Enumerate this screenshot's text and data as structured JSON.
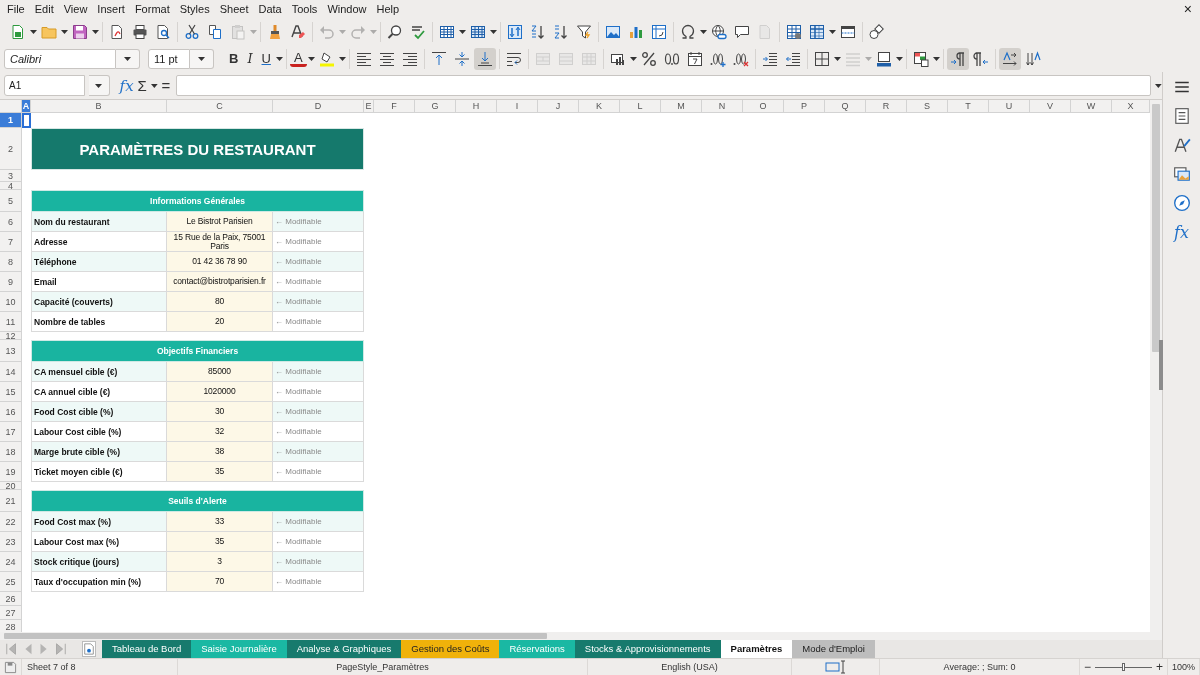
{
  "menu": [
    "File",
    "Edit",
    "View",
    "Insert",
    "Format",
    "Styles",
    "Sheet",
    "Data",
    "Tools",
    "Window",
    "Help"
  ],
  "close_label": "×",
  "standard_toolbar": [
    [
      {
        "kind": "new",
        "disabled": false
      },
      {
        "kind": "open",
        "disabled": false
      },
      {
        "kind": "save",
        "disabled": false
      }
    ],
    [
      {
        "kind": "pdf",
        "disabled": false
      },
      {
        "kind": "print",
        "disabled": false
      },
      {
        "kind": "preview",
        "disabled": false
      }
    ],
    [
      {
        "kind": "cut",
        "disabled": false
      },
      {
        "kind": "copy",
        "disabled": false
      },
      {
        "kind": "paste",
        "disabled": true
      }
    ],
    [
      {
        "kind": "clone",
        "disabled": false
      },
      {
        "kind": "clear",
        "disabled": false
      }
    ],
    [
      {
        "kind": "undo",
        "disabled": true
      },
      {
        "kind": "redo",
        "disabled": true
      }
    ],
    [
      {
        "kind": "find",
        "disabled": false
      },
      {
        "kind": "spelling",
        "disabled": false
      }
    ],
    [
      {
        "kind": "rows",
        "disabled": false
      },
      {
        "kind": "columns",
        "disabled": false
      }
    ],
    [
      {
        "kind": "sort",
        "disabled": false
      },
      {
        "kind": "sort-asc",
        "disabled": false
      },
      {
        "kind": "sort-desc",
        "disabled": false
      },
      {
        "kind": "filter",
        "disabled": false
      }
    ],
    [
      {
        "kind": "image",
        "disabled": false
      },
      {
        "kind": "chart",
        "disabled": false
      },
      {
        "kind": "pivot",
        "disabled": false
      }
    ],
    [
      {
        "kind": "special",
        "disabled": false
      },
      {
        "kind": "hyperlink",
        "disabled": false
      },
      {
        "kind": "comment",
        "disabled": false
      },
      {
        "kind": "header-footer",
        "disabled": true
      }
    ],
    [
      {
        "kind": "print-range",
        "disabled": false
      },
      {
        "kind": "freeze",
        "disabled": false
      },
      {
        "kind": "split",
        "disabled": false
      }
    ],
    [
      {
        "kind": "shapes",
        "disabled": false
      }
    ]
  ],
  "font_name": "Calibri",
  "font_size": "11 pt",
  "formatting_toolbar": [
    [
      {
        "kind": "bold",
        "label": "B",
        "disabled": false,
        "on": false
      },
      {
        "kind": "italic",
        "label": "I",
        "disabled": false,
        "on": false
      },
      {
        "kind": "underline",
        "label": "U",
        "disabled": false,
        "on": false
      }
    ],
    [
      {
        "kind": "font-color",
        "label": "A",
        "disabled": false,
        "on": false
      },
      {
        "kind": "highlight",
        "disabled": false,
        "on": false
      }
    ],
    [
      {
        "kind": "align-left",
        "disabled": false,
        "on": false
      },
      {
        "kind": "align-center",
        "disabled": false,
        "on": false
      },
      {
        "kind": "align-right",
        "disabled": false,
        "on": false
      }
    ],
    [
      {
        "kind": "align-top",
        "disabled": false,
        "on": false
      },
      {
        "kind": "align-middle",
        "disabled": false,
        "on": false
      },
      {
        "kind": "align-bottom",
        "disabled": false,
        "on": true
      }
    ],
    [
      {
        "kind": "wrap",
        "disabled": false,
        "on": false
      }
    ],
    [
      {
        "kind": "merge-center",
        "disabled": true,
        "on": false
      },
      {
        "kind": "merge",
        "disabled": true,
        "on": false
      },
      {
        "kind": "unmerge",
        "disabled": true,
        "on": false
      }
    ],
    [
      {
        "kind": "number-format",
        "disabled": false,
        "on": false
      },
      {
        "kind": "percent",
        "disabled": false,
        "on": false
      },
      {
        "kind": "standard-number",
        "disabled": false,
        "on": false
      },
      {
        "kind": "date",
        "disabled": false,
        "on": false
      },
      {
        "kind": "add-decimal",
        "disabled": false,
        "on": false
      },
      {
        "kind": "delete-decimal",
        "disabled": false,
        "on": false
      }
    ],
    [
      {
        "kind": "indent",
        "disabled": false,
        "on": false
      },
      {
        "kind": "outdent",
        "disabled": false,
        "on": false
      }
    ],
    [
      {
        "kind": "borders",
        "disabled": false,
        "on": false
      },
      {
        "kind": "border-style",
        "disabled": true,
        "on": false
      },
      {
        "kind": "border-color",
        "disabled": false,
        "on": false
      }
    ],
    [
      {
        "kind": "conditional",
        "disabled": false,
        "on": false
      }
    ],
    [
      {
        "kind": "ltr",
        "disabled": false,
        "on": true
      },
      {
        "kind": "rtl",
        "disabled": false,
        "on": false
      }
    ],
    [
      {
        "kind": "text-ltr",
        "disabled": false,
        "on": true
      },
      {
        "kind": "text-ttb",
        "disabled": false,
        "on": false
      }
    ]
  ],
  "formula_bar": {
    "name_box": "A1",
    "function_wizard": "fx",
    "sum": "Σ",
    "equals": "="
  },
  "grid": {
    "columns": [
      {
        "label": "A",
        "selected": true
      },
      {
        "label": "B",
        "selected": false
      },
      {
        "label": "C",
        "selected": false
      },
      {
        "label": "D",
        "selected": false
      },
      {
        "label": "E",
        "selected": false
      },
      {
        "label": "F",
        "selected": false
      },
      {
        "label": "G",
        "selected": false
      },
      {
        "label": "H",
        "selected": false
      },
      {
        "label": "I",
        "selected": false
      },
      {
        "label": "J",
        "selected": false
      },
      {
        "label": "K",
        "selected": false
      },
      {
        "label": "L",
        "selected": false
      },
      {
        "label": "M",
        "selected": false
      },
      {
        "label": "N",
        "selected": false
      },
      {
        "label": "O",
        "selected": false
      },
      {
        "label": "P",
        "selected": false
      },
      {
        "label": "Q",
        "selected": false
      },
      {
        "label": "R",
        "selected": false
      },
      {
        "label": "S",
        "selected": false
      },
      {
        "label": "T",
        "selected": false
      },
      {
        "label": "U",
        "selected": false
      },
      {
        "label": "V",
        "selected": false
      },
      {
        "label": "W",
        "selected": false
      },
      {
        "label": "X",
        "selected": false
      }
    ],
    "rows": [
      {
        "label": "1",
        "selected": true
      },
      {
        "label": "2",
        "selected": false
      },
      {
        "label": "3",
        "selected": false
      },
      {
        "label": "4",
        "selected": false
      },
      {
        "label": "5",
        "selected": false
      },
      {
        "label": "6",
        "selected": false
      },
      {
        "label": "7",
        "selected": false
      },
      {
        "label": "8",
        "selected": false
      },
      {
        "label": "9",
        "selected": false
      },
      {
        "label": "10",
        "selected": false
      },
      {
        "label": "11",
        "selected": false
      },
      {
        "label": "12",
        "selected": false
      },
      {
        "label": "13",
        "selected": false
      },
      {
        "label": "14",
        "selected": false
      },
      {
        "label": "15",
        "selected": false
      },
      {
        "label": "16",
        "selected": false
      },
      {
        "label": "17",
        "selected": false
      },
      {
        "label": "18",
        "selected": false
      },
      {
        "label": "19",
        "selected": false
      },
      {
        "label": "20",
        "selected": false
      },
      {
        "label": "21",
        "selected": false
      },
      {
        "label": "22",
        "selected": false
      },
      {
        "label": "23",
        "selected": false
      },
      {
        "label": "24",
        "selected": false
      },
      {
        "label": "25",
        "selected": false
      },
      {
        "label": "26",
        "selected": false
      },
      {
        "label": "27",
        "selected": false
      },
      {
        "label": "28",
        "selected": false
      }
    ]
  },
  "sheet": {
    "title": "PARAMÈTRES DU RESTAURANT",
    "sections": [
      {
        "title": "Informations Générales",
        "rows": [
          {
            "label": "Nom du restaurant",
            "value": "Le Bistrot Parisien",
            "note": "← Modifiable"
          },
          {
            "label": "Adresse",
            "value": "15 Rue de la Paix, 75001 Paris",
            "note": "← Modifiable"
          },
          {
            "label": "Téléphone",
            "value": "01 42 36 78 90",
            "note": "← Modifiable"
          },
          {
            "label": "Email",
            "value": "contact@bistrotparisien.fr",
            "note": "← Modifiable"
          },
          {
            "label": "Capacité (couverts)",
            "value": "80",
            "note": "← Modifiable"
          },
          {
            "label": "Nombre de tables",
            "value": "20",
            "note": "← Modifiable"
          }
        ]
      },
      {
        "title": "Objectifs Financiers",
        "rows": [
          {
            "label": "CA mensuel cible (€)",
            "value": "85000",
            "note": "← Modifiable"
          },
          {
            "label": "CA annuel cible (€)",
            "value": "1020000",
            "note": "← Modifiable"
          },
          {
            "label": "Food Cost cible (%)",
            "value": "30",
            "note": "← Modifiable"
          },
          {
            "label": "Labour Cost cible (%)",
            "value": "32",
            "note": "← Modifiable"
          },
          {
            "label": "Marge brute cible (%)",
            "value": "38",
            "note": "← Modifiable"
          },
          {
            "label": "Ticket moyen cible (€)",
            "value": "35",
            "note": "← Modifiable"
          }
        ]
      },
      {
        "title": "Seuils d'Alerte",
        "rows": [
          {
            "label": "Food Cost max (%)",
            "value": "33",
            "note": "← Modifiable"
          },
          {
            "label": "Labour Cost max (%)",
            "value": "35",
            "note": "← Modifiable"
          },
          {
            "label": "Stock critique (jours)",
            "value": "3",
            "note": "← Modifiable"
          },
          {
            "label": "Taux d'occupation min (%)",
            "value": "70",
            "note": "← Modifiable"
          }
        ]
      }
    ]
  },
  "sheet_tabs": [
    {
      "label": "Tableau de Bord",
      "color": "#177a6d",
      "selected": false
    },
    {
      "label": "Saisie Journalière",
      "color": "#1ab8a3",
      "selected": false
    },
    {
      "label": "Analyse & Graphiques",
      "color": "#177a6d",
      "selected": false
    },
    {
      "label": "Gestion des Coûts",
      "color": "#f0b20a",
      "selected": false
    },
    {
      "label": "Réservations",
      "color": "#1ab8a3",
      "selected": false
    },
    {
      "label": "Stocks & Approvisionnements",
      "color": "#177a6d",
      "selected": false
    },
    {
      "label": "Paramètres",
      "selected": true
    },
    {
      "label": "Mode d'Emploi",
      "color": "#bdbdbd",
      "selected": false
    }
  ],
  "status_bar": {
    "sheet_position": "Sheet 7 of 8",
    "page_style": "PageStyle_Paramètres",
    "language": "English (USA)",
    "selection_summary": "Average: ; Sum: 0",
    "zoom_out": "−",
    "zoom": {
      "level": 0.5
    },
    "zoom_in": "+",
    "zoom_percent": "100%"
  },
  "sidebar": {
    "functions": "fx"
  }
}
